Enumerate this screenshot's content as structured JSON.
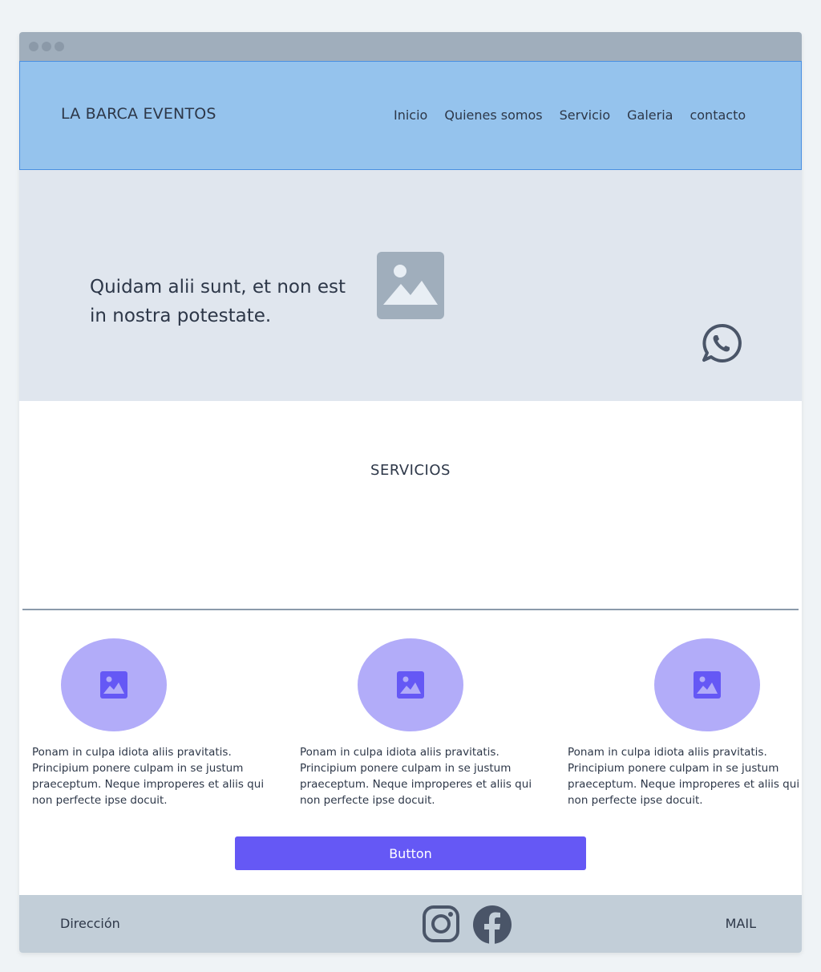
{
  "colors": {
    "page_bg": "#eff3f6",
    "titlebar": "#a0aebc",
    "header_bg": "#95c3ed",
    "hero_bg": "#e0e6ee",
    "accent": "#6558f5",
    "service_circle": "#b2acf9",
    "footer_bg": "#c2ced8",
    "text": "#2d3748"
  },
  "header": {
    "brand": "LA BARCA EVENTOS",
    "nav": [
      "Inicio",
      "Quienes somos",
      "Servicio",
      "Galeria",
      "contacto"
    ]
  },
  "hero": {
    "text": "Quidam alii sunt, et non est in nostra potestate.",
    "image_icon": "image-icon",
    "contact_icon": "whatsapp-icon"
  },
  "services": {
    "title": "SERVICIOS",
    "items": [
      {
        "icon": "image-icon",
        "text": "Ponam in culpa idiota aliis pravitatis. Principium ponere culpam in se justum praeceptum. Neque improperes et aliis qui non perfecte ipse docuit."
      },
      {
        "icon": "image-icon",
        "text": "Ponam in culpa idiota aliis pravitatis. Principium ponere culpam in se justum praeceptum. Neque improperes et aliis qui non perfecte ipse docuit."
      },
      {
        "icon": "image-icon",
        "text": "Ponam in culpa idiota aliis pravitatis. Principium ponere culpam in se justum praeceptum. Neque improperes et aliis qui non perfecte ipse docuit."
      }
    ],
    "button_label": "Button"
  },
  "footer": {
    "address": "Dirección",
    "mail": "MAIL",
    "social": [
      "instagram-icon",
      "facebook-icon"
    ]
  }
}
